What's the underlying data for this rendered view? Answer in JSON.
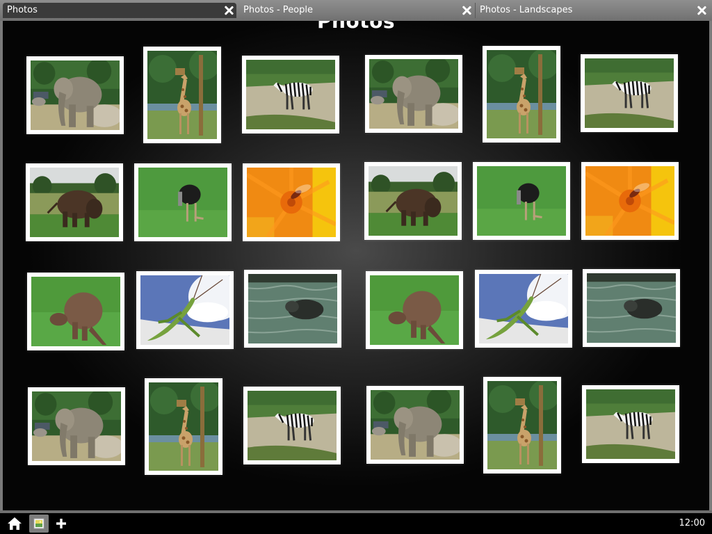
{
  "tabs": [
    {
      "label": "Photos",
      "active": true
    },
    {
      "label": "Photos - People",
      "active": false
    },
    {
      "label": "Photos - Landscapes",
      "active": false
    }
  ],
  "page": {
    "title": "Photos"
  },
  "photos": [
    {
      "subject": "elephant"
    },
    {
      "subject": "giraffe"
    },
    {
      "subject": "zebra"
    },
    {
      "subject": "elephant"
    },
    {
      "subject": "giraffe"
    },
    {
      "subject": "zebra"
    },
    {
      "subject": "bison"
    },
    {
      "subject": "ostrich"
    },
    {
      "subject": "orange-flower-with-bee"
    },
    {
      "subject": "bison"
    },
    {
      "subject": "ostrich"
    },
    {
      "subject": "orange-flower-with-bee"
    },
    {
      "subject": "wallaby"
    },
    {
      "subject": "praying-mantis"
    },
    {
      "subject": "hippo-in-water"
    },
    {
      "subject": "wallaby"
    },
    {
      "subject": "praying-mantis"
    },
    {
      "subject": "hippo-in-water"
    },
    {
      "subject": "elephant"
    },
    {
      "subject": "giraffe"
    },
    {
      "subject": "zebra"
    },
    {
      "subject": "elephant"
    },
    {
      "subject": "giraffe"
    },
    {
      "subject": "zebra"
    }
  ],
  "taskbar": {
    "icons": [
      "home-icon",
      "photos-app-icon",
      "plus-icon"
    ],
    "clock": "12:00"
  }
}
